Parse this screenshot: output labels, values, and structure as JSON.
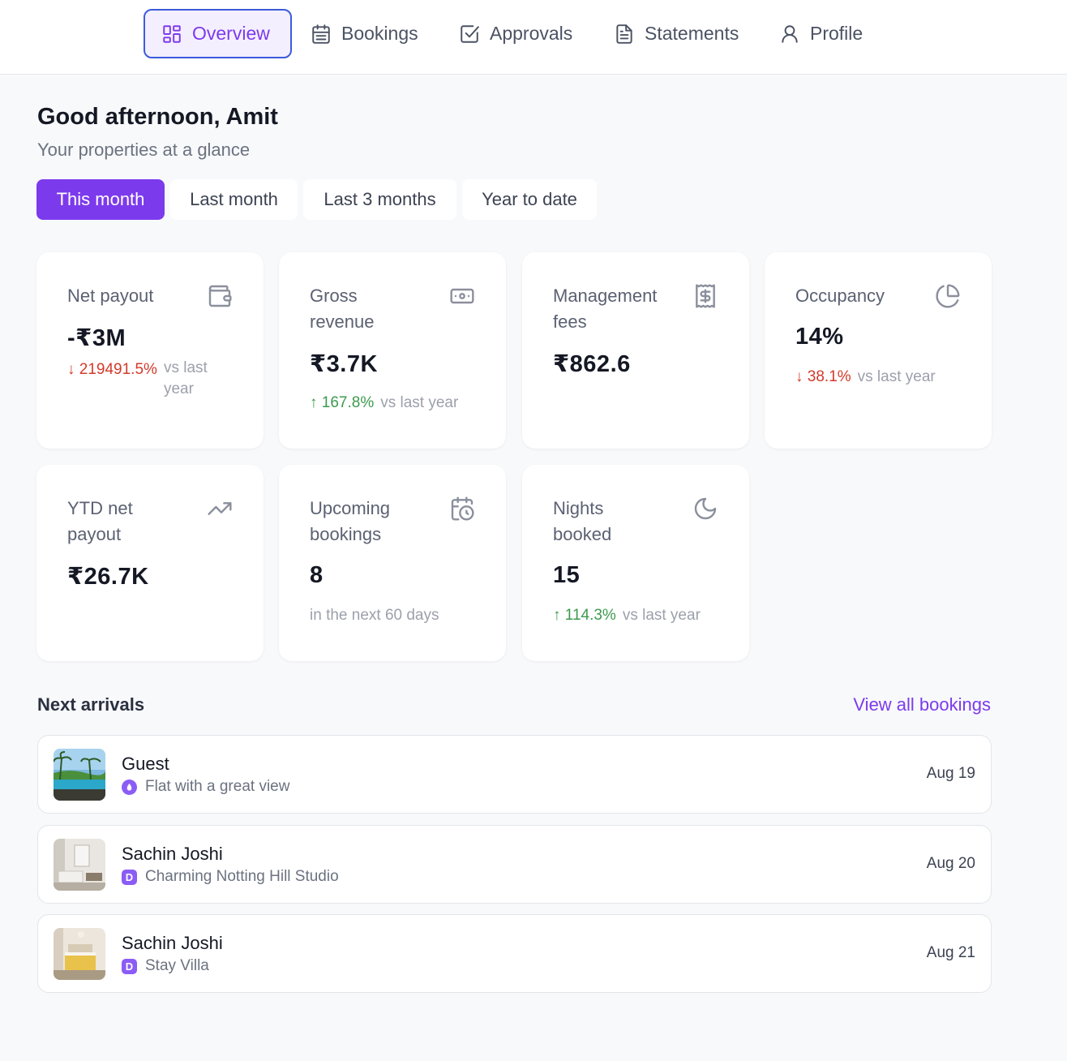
{
  "nav": {
    "tabs": [
      {
        "label": "Overview",
        "icon": "grid-icon",
        "active": true
      },
      {
        "label": "Bookings",
        "icon": "calendar-icon"
      },
      {
        "label": "Approvals",
        "icon": "checkbox-icon"
      },
      {
        "label": "Statements",
        "icon": "document-icon"
      },
      {
        "label": "Profile",
        "icon": "user-icon"
      }
    ]
  },
  "header": {
    "greeting": "Good afternoon, Amit",
    "subtitle": "Your properties at a glance"
  },
  "periods": [
    "This month",
    "Last month",
    "Last 3 months",
    "Year to date"
  ],
  "selected_period": "This month",
  "cards": [
    {
      "label": "Net payout",
      "icon": "wallet-icon",
      "value": "-₹3M",
      "trend": "219491.5%",
      "trend_dir": "down",
      "trend_suffix": "vs last year"
    },
    {
      "label": "Gross revenue",
      "icon": "banknote-icon",
      "value": "₹3.7K",
      "trend": "167.8%",
      "trend_dir": "up",
      "trend_suffix": "vs last year"
    },
    {
      "label": "Management fees",
      "icon": "receipt-icon",
      "value": "₹862.6"
    },
    {
      "label": "Occupancy",
      "icon": "pie-chart-icon",
      "value": "14%",
      "trend": "38.1%",
      "trend_dir": "down",
      "trend_suffix": "vs last year"
    },
    {
      "label": "YTD net payout",
      "icon": "trending-up-icon",
      "value": "₹26.7K"
    },
    {
      "label": "Upcoming bookings",
      "icon": "calendar-clock-icon",
      "value": "8",
      "note": "in the next 60 days"
    },
    {
      "label": "Nights booked",
      "icon": "moon-icon",
      "value": "15",
      "trend": "114.3%",
      "trend_dir": "up",
      "trend_suffix": "vs last year"
    }
  ],
  "arrivals": {
    "title": "Next arrivals",
    "link": "View all bookings",
    "items": [
      {
        "guest": "Guest",
        "property": "Flat with a great view",
        "channel_badge": "",
        "date": "Aug 19"
      },
      {
        "guest": "Sachin Joshi",
        "property": "Charming Notting Hill Studio",
        "channel_badge": "D",
        "date": "Aug 20"
      },
      {
        "guest": "Sachin Joshi",
        "property": "Stay Villa",
        "channel_badge": "D",
        "date": "Aug 21"
      }
    ]
  },
  "colors": {
    "accent": "#7c3aed",
    "trend_down": "#d33a2c",
    "trend_up": "#3e9a4e",
    "focus_ring": "#3b5bdb"
  }
}
